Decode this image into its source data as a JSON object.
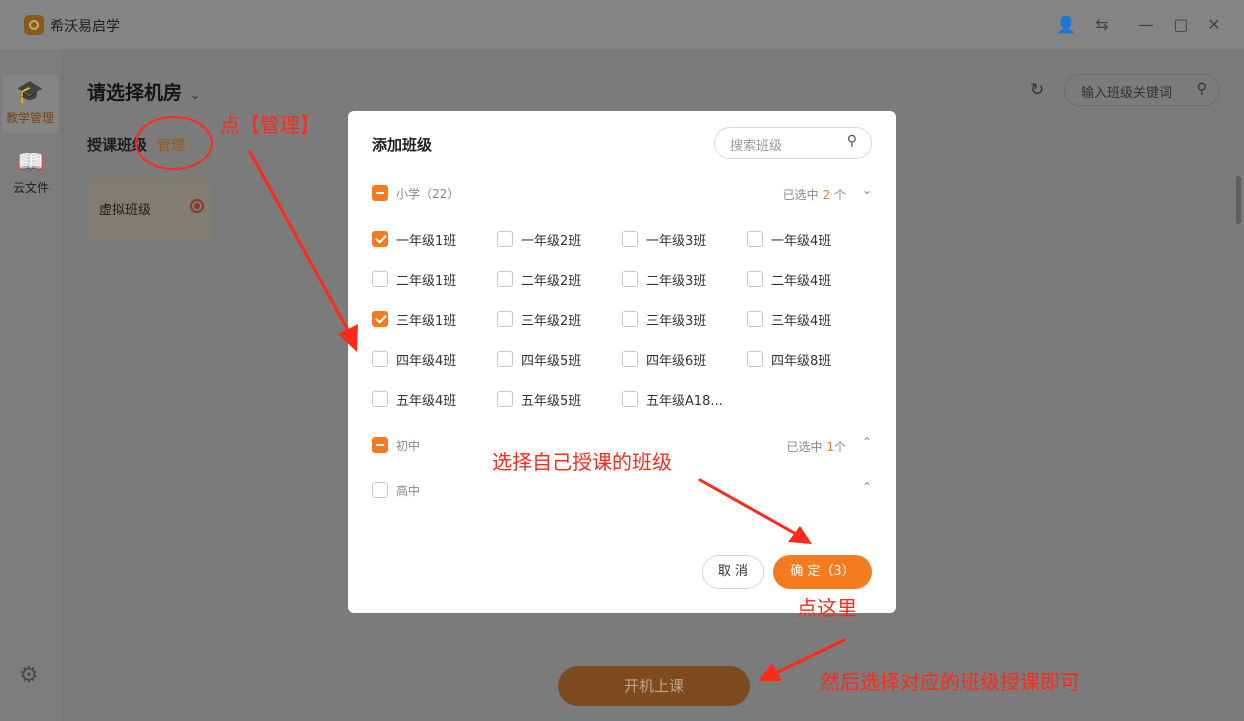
{
  "app": {
    "title": "希沃易启学"
  },
  "sidebar": {
    "items": [
      {
        "label": "教学管理",
        "icon": "graduation-cap-icon",
        "active": true
      },
      {
        "label": "云文件",
        "icon": "book-icon",
        "active": false
      }
    ]
  },
  "main": {
    "room_title": "请选择机房",
    "search_placeholder": "输入班级关键词",
    "section_title": "授课班级",
    "manage_label": "管理",
    "class_card_label": "虚拟班级",
    "start_button": "开机上课"
  },
  "modal": {
    "title": "添加班级",
    "search_placeholder": "搜索班级",
    "groups": [
      {
        "name": "小学（22）",
        "state": "partial",
        "selected_prefix": "已选中",
        "selected_count": "2",
        "selected_suffix": "个",
        "expanded": true
      },
      {
        "name": "初中",
        "state": "partial",
        "selected_prefix": "已选中",
        "selected_count": "1",
        "selected_suffix": "个",
        "expanded": false
      },
      {
        "name": "高中",
        "state": "none",
        "expanded": false
      }
    ],
    "classes": [
      {
        "label": "一年级1班",
        "checked": true
      },
      {
        "label": "一年级2班",
        "checked": false
      },
      {
        "label": "一年级3班",
        "checked": false
      },
      {
        "label": "一年级4班",
        "checked": false
      },
      {
        "label": "二年级1班",
        "checked": false
      },
      {
        "label": "二年级2班",
        "checked": false
      },
      {
        "label": "二年级3班",
        "checked": false
      },
      {
        "label": "二年级4班",
        "checked": false
      },
      {
        "label": "三年级1班",
        "checked": true
      },
      {
        "label": "三年级2班",
        "checked": false
      },
      {
        "label": "三年级3班",
        "checked": false
      },
      {
        "label": "三年级4班",
        "checked": false
      },
      {
        "label": "四年级4班",
        "checked": false
      },
      {
        "label": "四年级5班",
        "checked": false
      },
      {
        "label": "四年级6班",
        "checked": false
      },
      {
        "label": "四年级8班",
        "checked": false
      },
      {
        "label": "五年级4班",
        "checked": false
      },
      {
        "label": "五年级5班",
        "checked": false
      },
      {
        "label": "五年级A18...",
        "checked": false
      }
    ],
    "cancel_label": "取 消",
    "ok_label": "确 定（3）"
  },
  "annotations": {
    "click_manage": "点【管理】",
    "select_classes": "选择自己授课的班级",
    "click_here": "点这里",
    "then_select": "然后选择对应的班级授课即可",
    "color": "#ff2a1a"
  }
}
